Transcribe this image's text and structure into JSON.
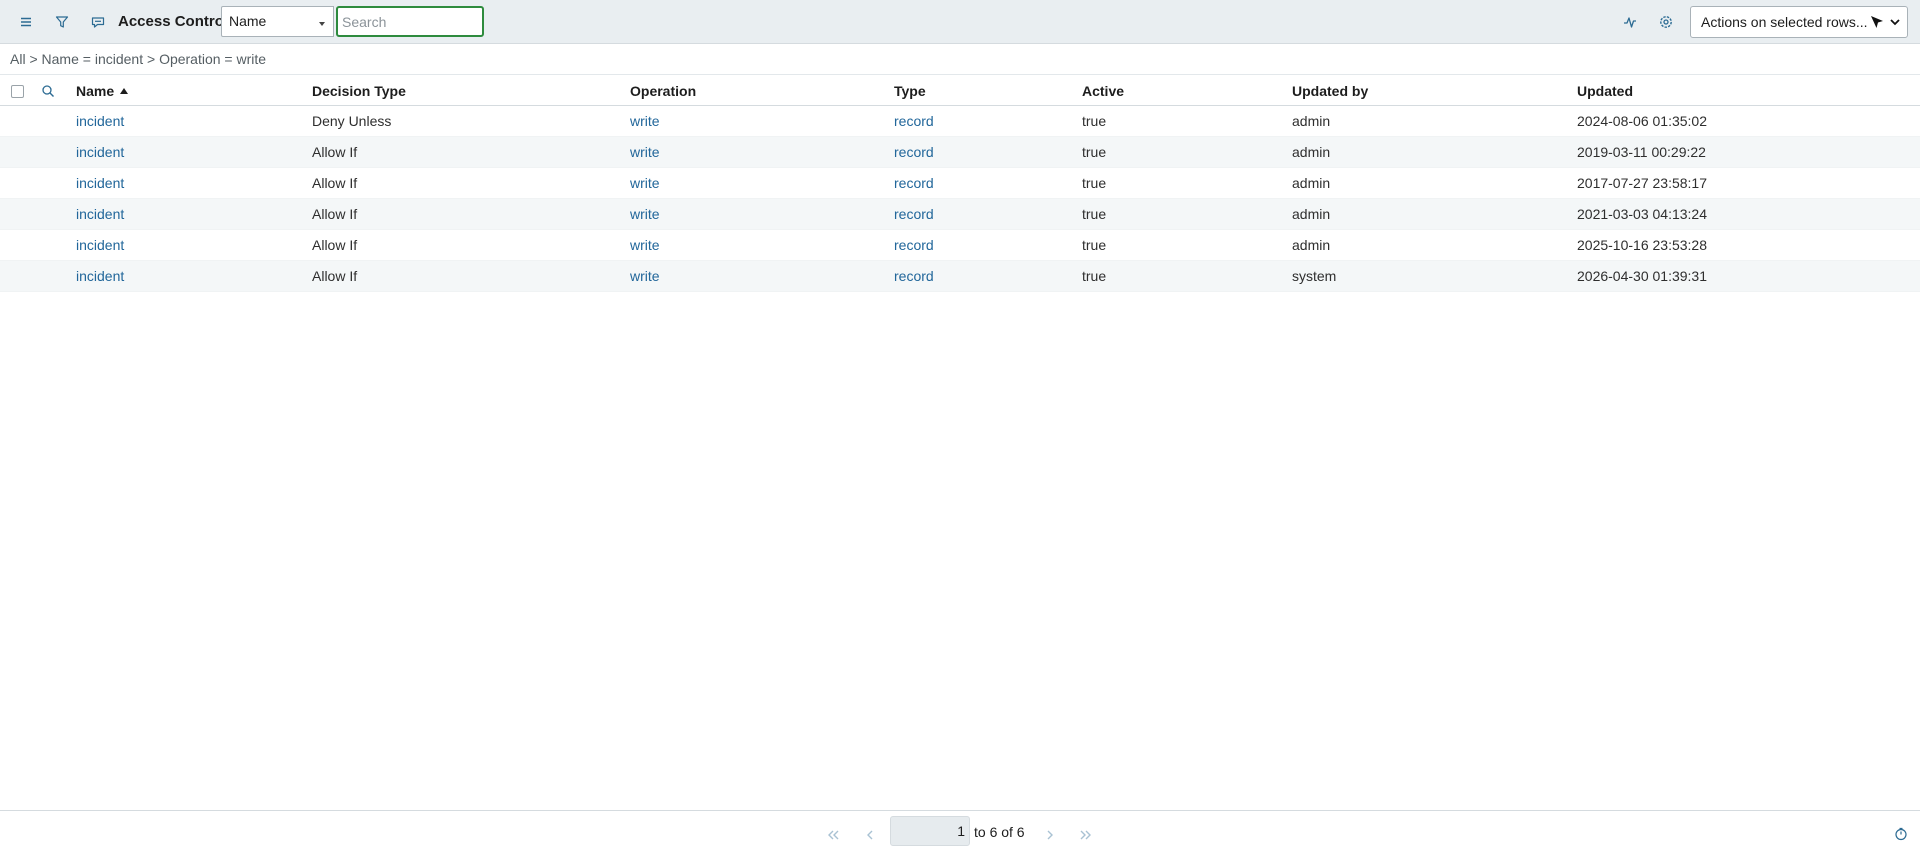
{
  "toolbar": {
    "title": "Access Controls",
    "field_select_value": "Name",
    "search_placeholder": "Search",
    "actions_label": "Actions on selected rows...",
    "icons": [
      "hamburger-menu-icon",
      "filter-icon",
      "comment-icon",
      "sparkline-icon",
      "gear-icon",
      "cursor-icon",
      "chevron-down-icon"
    ]
  },
  "breadcrumb": {
    "parts": [
      "All",
      " > ",
      "Name = incident",
      " > ",
      "Operation = write"
    ]
  },
  "table": {
    "columns": [
      "Name",
      "Decision Type",
      "Operation",
      "Type",
      "Active",
      "Updated by",
      "Updated"
    ],
    "sort_column": "Name",
    "sort_direction": "ascending",
    "rows": [
      {
        "name": "incident",
        "decision_type": "Deny Unless",
        "operation": "write",
        "type": "record",
        "active": "true",
        "updated_by": "admin",
        "updated": "2024-08-06 01:35:02"
      },
      {
        "name": "incident",
        "decision_type": "Allow If",
        "operation": "write",
        "type": "record",
        "active": "true",
        "updated_by": "admin",
        "updated": "2019-03-11 00:29:22"
      },
      {
        "name": "incident",
        "decision_type": "Allow If",
        "operation": "write",
        "type": "record",
        "active": "true",
        "updated_by": "admin",
        "updated": "2017-07-27 23:58:17"
      },
      {
        "name": "incident",
        "decision_type": "Allow If",
        "operation": "write",
        "type": "record",
        "active": "true",
        "updated_by": "admin",
        "updated": "2021-03-03 04:13:24"
      },
      {
        "name": "incident",
        "decision_type": "Allow If",
        "operation": "write",
        "type": "record",
        "active": "true",
        "updated_by": "admin",
        "updated": "2025-10-16 23:53:28"
      },
      {
        "name": "incident",
        "decision_type": "Allow If",
        "operation": "write",
        "type": "record",
        "active": "true",
        "updated_by": "system",
        "updated": "2026-04-30 01:39:31"
      }
    ]
  },
  "pagination": {
    "current_page": "1",
    "range_text": "to 6 of 6"
  },
  "colors": {
    "link": "#21669a",
    "toolbar_bg": "#e9eef1",
    "search_focus_border": "#2e8b3e",
    "alt_row_bg": "#f4f7f8"
  }
}
